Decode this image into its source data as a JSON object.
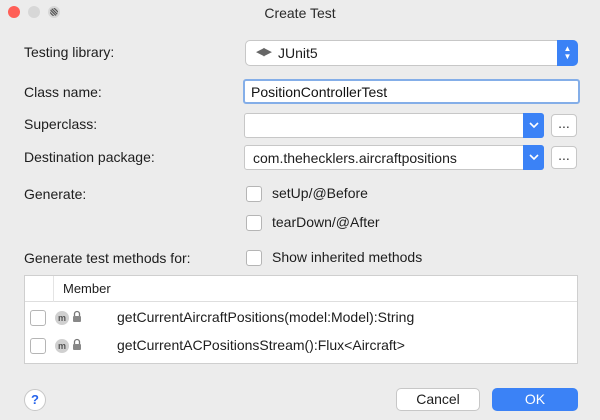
{
  "window": {
    "title": "Create Test"
  },
  "form": {
    "testing_library": {
      "label": "Testing library:",
      "value": "JUnit5",
      "icon": "junit-icon"
    },
    "class_name": {
      "label": "Class name:",
      "value": "PositionControllerTest"
    },
    "superclass": {
      "label": "Superclass:",
      "value": ""
    },
    "destination_package": {
      "label": "Destination package:",
      "value": "com.thehecklers.aircraftpositions"
    },
    "ellipsis_label": "...",
    "generate": {
      "label": "Generate:",
      "options": [
        {
          "label": "setUp/@Before",
          "checked": false
        },
        {
          "label": "tearDown/@After",
          "checked": false
        }
      ]
    },
    "generate_methods_for": {
      "label": "Generate test methods for:",
      "show_inherited": {
        "label": "Show inherited methods",
        "checked": false
      }
    }
  },
  "members_table": {
    "header": "Member",
    "rows": [
      {
        "badge": "m",
        "signature": "getCurrentAircraftPositions(model:Model):String",
        "checked": false
      },
      {
        "badge": "m",
        "signature": "getCurrentACPositionsStream():Flux<Aircraft>",
        "checked": false
      }
    ]
  },
  "footer": {
    "help_label": "?",
    "cancel_label": "Cancel",
    "ok_label": "OK"
  },
  "colors": {
    "accent": "#3b82f6",
    "focus_border": "#84aee8",
    "close": "#ff5f57"
  }
}
